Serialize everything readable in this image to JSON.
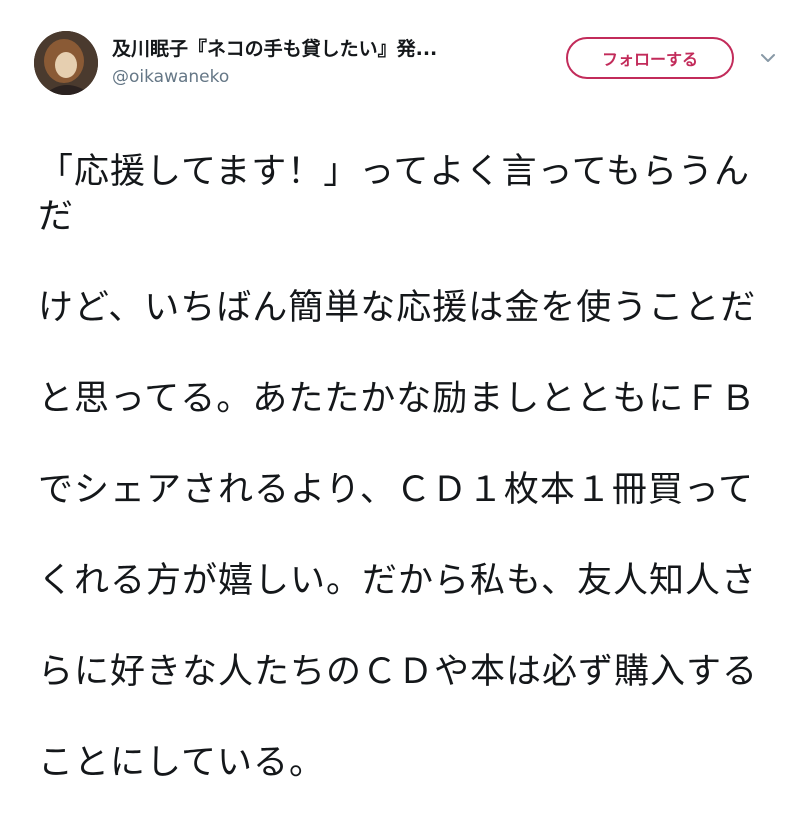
{
  "author": {
    "display_name": "及川眠子『ネコの手も貸したい』発...",
    "handle": "@oikawaneko",
    "avatar_icon": "profile-photo"
  },
  "actions": {
    "follow_label": "フォローする",
    "menu_icon": "chevron-down-icon"
  },
  "tweet": {
    "lines": [
      "「応援してます！」ってよく言ってもらうんだ",
      "けど、いちばん簡単な応援は金を使うことだ",
      "と思ってる。あたたかな励ましとともにＦＢ",
      "でシェアされるより、ＣＤ１枚本１冊買って",
      "くれる方が嬉しい。だから私も、友人知人さ",
      "らに好きな人たちのＣＤや本は必ず購入する",
      "ことにしている。"
    ]
  },
  "colors": {
    "accent": "#c22b5a",
    "secondary_text": "#657786",
    "primary_text": "#14171a"
  }
}
